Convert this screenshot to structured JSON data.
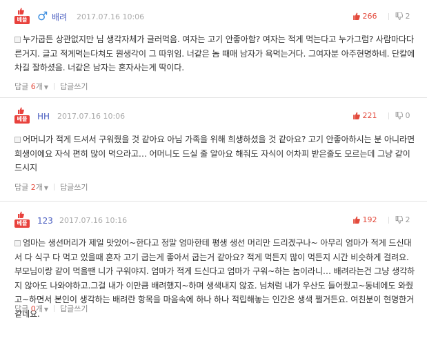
{
  "common": {
    "best_label": "베플",
    "reply_label": "답글",
    "count_suffix": "개",
    "write_reply": "답글쓰기"
  },
  "comments": [
    {
      "gender_icon": "♂",
      "nickname": "배려",
      "date": "2017.07.16 10:06",
      "upvotes": "266",
      "downvotes": "2",
      "text": "누가굽든 상관없지만 님 생각자체가 글러먹음. 여자는 고기 안좋아함? 여자는 적게 먹는다고 누가그럼? 사람마다다른거지. 글고 적게먹는다쳐도 뭔생각이 그 따위임. 너같은 놈 때매 남자가 욕먹는거다. 그여자분 아주현명하네. 단칼에 차길 잘하셨음. 너같은 남자는 혼자사는게 딱이다.",
      "reply_count": "6"
    },
    {
      "nickname": "HH",
      "date": "2017.07.16 10:06",
      "upvotes": "221",
      "downvotes": "0",
      "text": "어머니가 적게 드셔서 구워줬을 것 같아요 아님 가족을 위해 희생하셨을 것 같아요? 고기 안좋아하시는 분 아니라면 희생이에요 자식 편히 많이 먹으라고… 어머니도 드실 줄 알아요 해줘도 자식이 어차피 받은줄도 모르는데 그냥 같이 드시지",
      "reply_count": "2"
    },
    {
      "nickname": "123",
      "date": "2017.07.16 10:16",
      "upvotes": "192",
      "downvotes": "2",
      "text": "엄마는 생선머리가 제일 맛있어~한다고 정말 엄마한테 평생 생선 머리만 드리겠구나~ 아무리 엄마가 적게 드신대서 다 식구 다 먹고 있을때 혼자 고기 굽는게 좋아서 굽는거 같아요? 적게 먹든지 많이 먹든지 시간 비슷하게 걸려요. 부모님이랑 같이 먹을땐 니가 구워야지. 엄마가 적게 드신다고 엄마가 구워~하는 놈이라니… 배려라는건 그냥 생각하지 않아도 나와야하고.그걸 내가 이만큼 배려했지~하며 생색내지 않죠. 님처럼 내가 우산도 들어줬고~동네에도 와줬고~하면서 본인이 생각하는 배려란 항목을 마음속에 하나 하나 적립해놓는 인간은 생색 쩔거든요. 여친분이 현명한거 같네요.",
      "reply_count": "0"
    }
  ],
  "colors": {
    "accent_red": "#e8413c",
    "male_blue": "#3c8ee0",
    "nick_blue": "#4a5ec0"
  }
}
